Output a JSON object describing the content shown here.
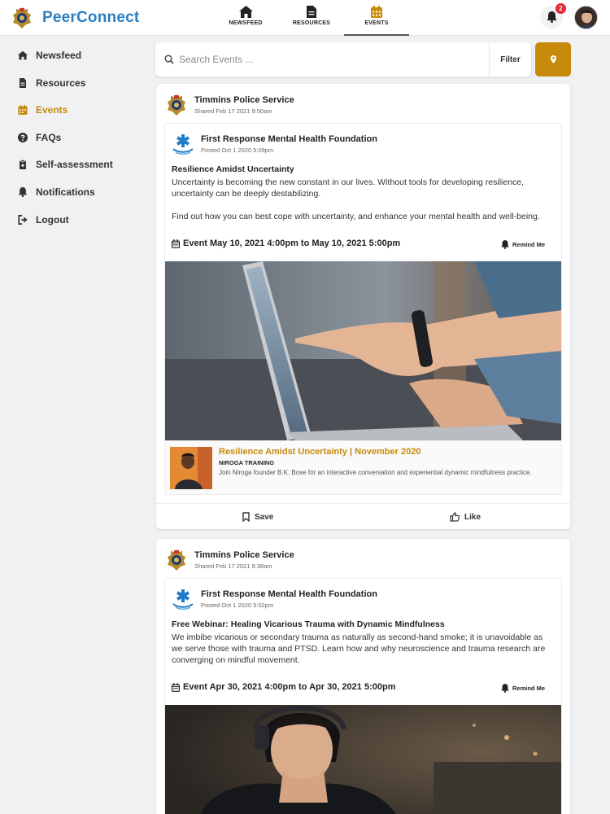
{
  "app": {
    "brand": "PeerConnect"
  },
  "topnav": [
    {
      "label": "NEWSFEED",
      "icon": "home-icon"
    },
    {
      "label": "RESOURCES",
      "icon": "document-icon"
    },
    {
      "label": "EVENTS",
      "icon": "calendar-icon",
      "active": true
    }
  ],
  "notifications": {
    "count": "2"
  },
  "sidebar": {
    "items": [
      {
        "label": "Newsfeed",
        "icon": "home-icon"
      },
      {
        "label": "Resources",
        "icon": "document-icon"
      },
      {
        "label": "Events",
        "icon": "calendar-icon",
        "active": true
      },
      {
        "label": "FAQs",
        "icon": "question-circle-icon"
      },
      {
        "label": "Self-assessment",
        "icon": "clipboard-icon"
      },
      {
        "label": "Notifications",
        "icon": "bell-icon"
      },
      {
        "label": "Logout",
        "icon": "logout-icon"
      }
    ]
  },
  "search": {
    "placeholder": "Search Events ...",
    "filter_label": "Filter"
  },
  "colors": {
    "accent": "#c78a0c",
    "brand": "#2c7fc1",
    "badge": "#e0293b"
  },
  "posts": [
    {
      "poster": "Timmins Police Service",
      "shared": "Shared Feb 17 2021 9:50am",
      "org": "First Response Mental Health Foundation",
      "posted": "Posted Oct 1 2020 5:09pm",
      "title": "Resilience Amidst Uncertainty",
      "desc1": "Uncertainty is becoming the new constant in our lives. Without tools for developing resilience, uncertainty can be deeply destabilizing.",
      "desc2": "Find out how you can best cope with uncertainty, and enhance your mental health and well-being.",
      "event_date": "Event May 10, 2021 4:00pm to May 10, 2021 5:00pm",
      "remind_label": "Remind Me",
      "link": {
        "title": "Resilience Amidst Uncertainty | November 2020",
        "source": "NIROGA TRAINING",
        "desc": "Join Niroga founder B.K. Bose for an interactive conversation and experiential dynamic mindfulness practice."
      },
      "save_label": "Save",
      "like_label": "Like"
    },
    {
      "poster": "Timmins Police Service",
      "shared": "Shared Feb 17 2021 9:38am",
      "org": "First Response Mental Health Foundation",
      "posted": "Posted Oct 1 2020 5:02pm",
      "title": "Free Webinar: Healing Vicarious Trauma with Dynamic Mindfulness",
      "desc1": "We imbibe vicarious or secondary trauma as naturally as second-hand smoke; it is unavoidable as we serve those with trauma and PTSD. Learn how and why neuroscience and trauma research are converging on mindful movement.",
      "event_date": "Event Apr 30, 2021 4:00pm to Apr 30, 2021 5:00pm",
      "remind_label": "Remind Me"
    }
  ]
}
